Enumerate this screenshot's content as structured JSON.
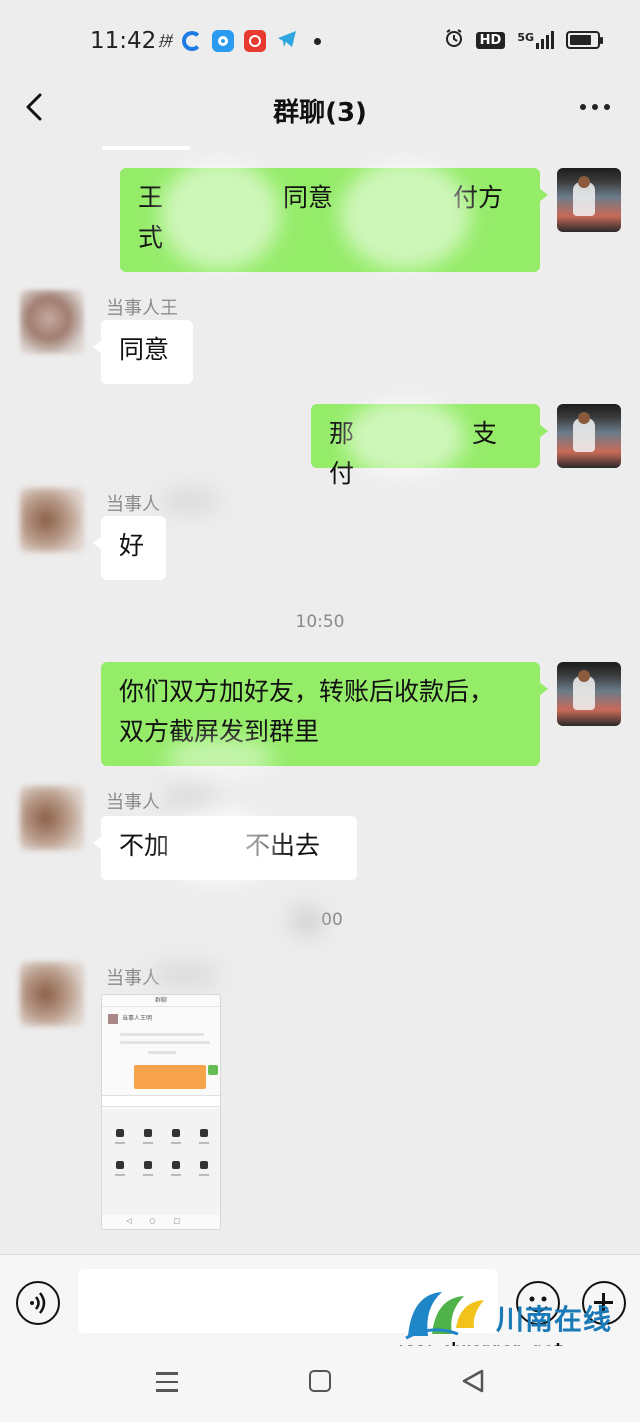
{
  "status_bar": {
    "time": "11:42",
    "network": "5G",
    "hd_badge": "HD"
  },
  "nav": {
    "title": "群聊(3)"
  },
  "messages": [
    {
      "side": "right",
      "type": "text",
      "line1": "王",
      "line1b": "同意",
      "line1c": "付方",
      "line2": "式"
    },
    {
      "side": "left",
      "type": "text",
      "sender": "当事人王",
      "text": "同意"
    },
    {
      "side": "right",
      "type": "text",
      "part1": "那",
      "part2": "支付"
    },
    {
      "side": "left",
      "type": "text",
      "sender": "当事人",
      "text": "好"
    },
    {
      "type": "time",
      "text": "10:50"
    },
    {
      "side": "right",
      "type": "text",
      "line1": "你们双方加好友，转账后收款后，",
      "line2": "双方截屏发到群里"
    },
    {
      "side": "left",
      "type": "text",
      "sender": "当事人",
      "part1": "不加",
      "part2": "不出去"
    },
    {
      "type": "time",
      "text": "00"
    },
    {
      "side": "left",
      "type": "image",
      "sender": "当事人"
    }
  ],
  "thumbnail": {
    "header": "群聊",
    "contact": "当事人王明"
  },
  "watermark": {
    "name": "川南在线",
    "url": "www.chuannan.net"
  },
  "colors": {
    "background": "#ededed",
    "bubble_mine": "#95ec69",
    "bubble_other": "#ffffff",
    "watermark_blue": "#1a7ab8"
  }
}
